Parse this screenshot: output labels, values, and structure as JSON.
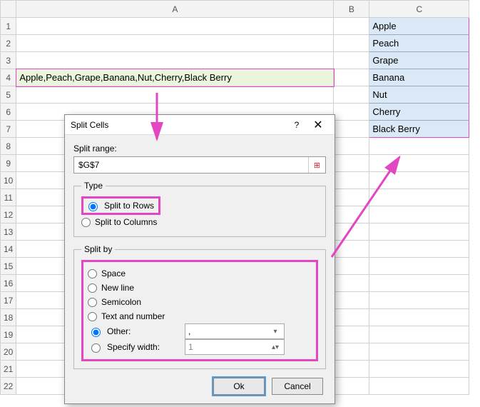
{
  "columns": {
    "A": "A",
    "B": "B",
    "C": "C"
  },
  "rows": [
    "1",
    "2",
    "3",
    "4",
    "5",
    "6",
    "7",
    "8",
    "9",
    "10",
    "11",
    "12",
    "13",
    "14",
    "15",
    "16",
    "17",
    "18",
    "19",
    "20",
    "21",
    "22"
  ],
  "cellA4": "Apple,Peach,Grape,Banana,Nut,Cherry,Black Berry",
  "resultC": [
    "Apple",
    "Peach",
    "Grape",
    "Banana",
    "Nut",
    "Cherry",
    "Black Berry"
  ],
  "dialog": {
    "title": "Split Cells",
    "help": "?",
    "close": "✕",
    "split_range_label": "Split range:",
    "split_range_value": "$G$7",
    "type_legend": "Type",
    "type_rows": "Split to Rows",
    "type_cols": "Split to Columns",
    "splitby_legend": "Split by",
    "sb_space": "Space",
    "sb_newline": "New line",
    "sb_semicolon": "Semicolon",
    "sb_textnum": "Text and number",
    "sb_other": "Other:",
    "sb_other_value": ",",
    "sb_width": "Specify width:",
    "sb_width_value": "1",
    "ok": "Ok",
    "cancel": "Cancel"
  }
}
